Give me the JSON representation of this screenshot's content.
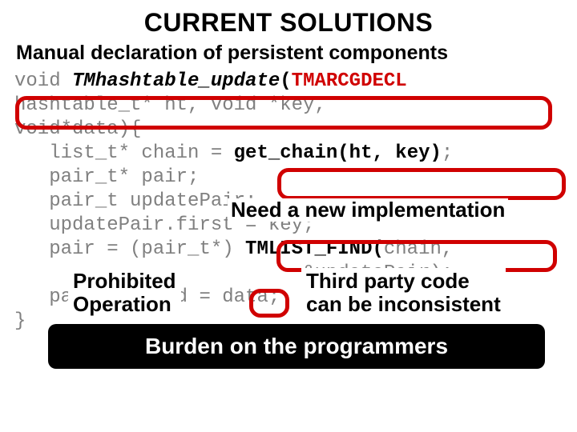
{
  "title": "CURRENT SOLUTIONS",
  "subtitle": "Manual declaration of persistent components",
  "code": {
    "l1a": "void ",
    "l1b": "TMhashtable_update",
    "l1c": "(",
    "l1d": "TMARCGDECL",
    "l2": "hashtable_t* ht, void *key,",
    "l3": "void*data){",
    "l4a": "   list_t* chain = ",
    "l4b": "get_chain(ht, key)",
    "l4c": ";",
    "l5": "   pair_t* pair;",
    "l6": "   pair_t updatePair;",
    "l7": "   updatePair.first = key;",
    "l8a": "   pair = (pair_t*) ",
    "l8b": "TMLIST_FIND(",
    "l8c": "chain,",
    "l9": "                         &updatePair);",
    "l10": "   pair->second = data;",
    "l11": "}"
  },
  "annotations": {
    "need_impl": "Need a new implementation",
    "prohibited_l1": "Prohibited",
    "prohibited_l2": "Operation",
    "third_l1": "Third party code",
    "third_l2": "can be inconsistent"
  },
  "banner": "Burden on the programmers",
  "eq_sign": "="
}
